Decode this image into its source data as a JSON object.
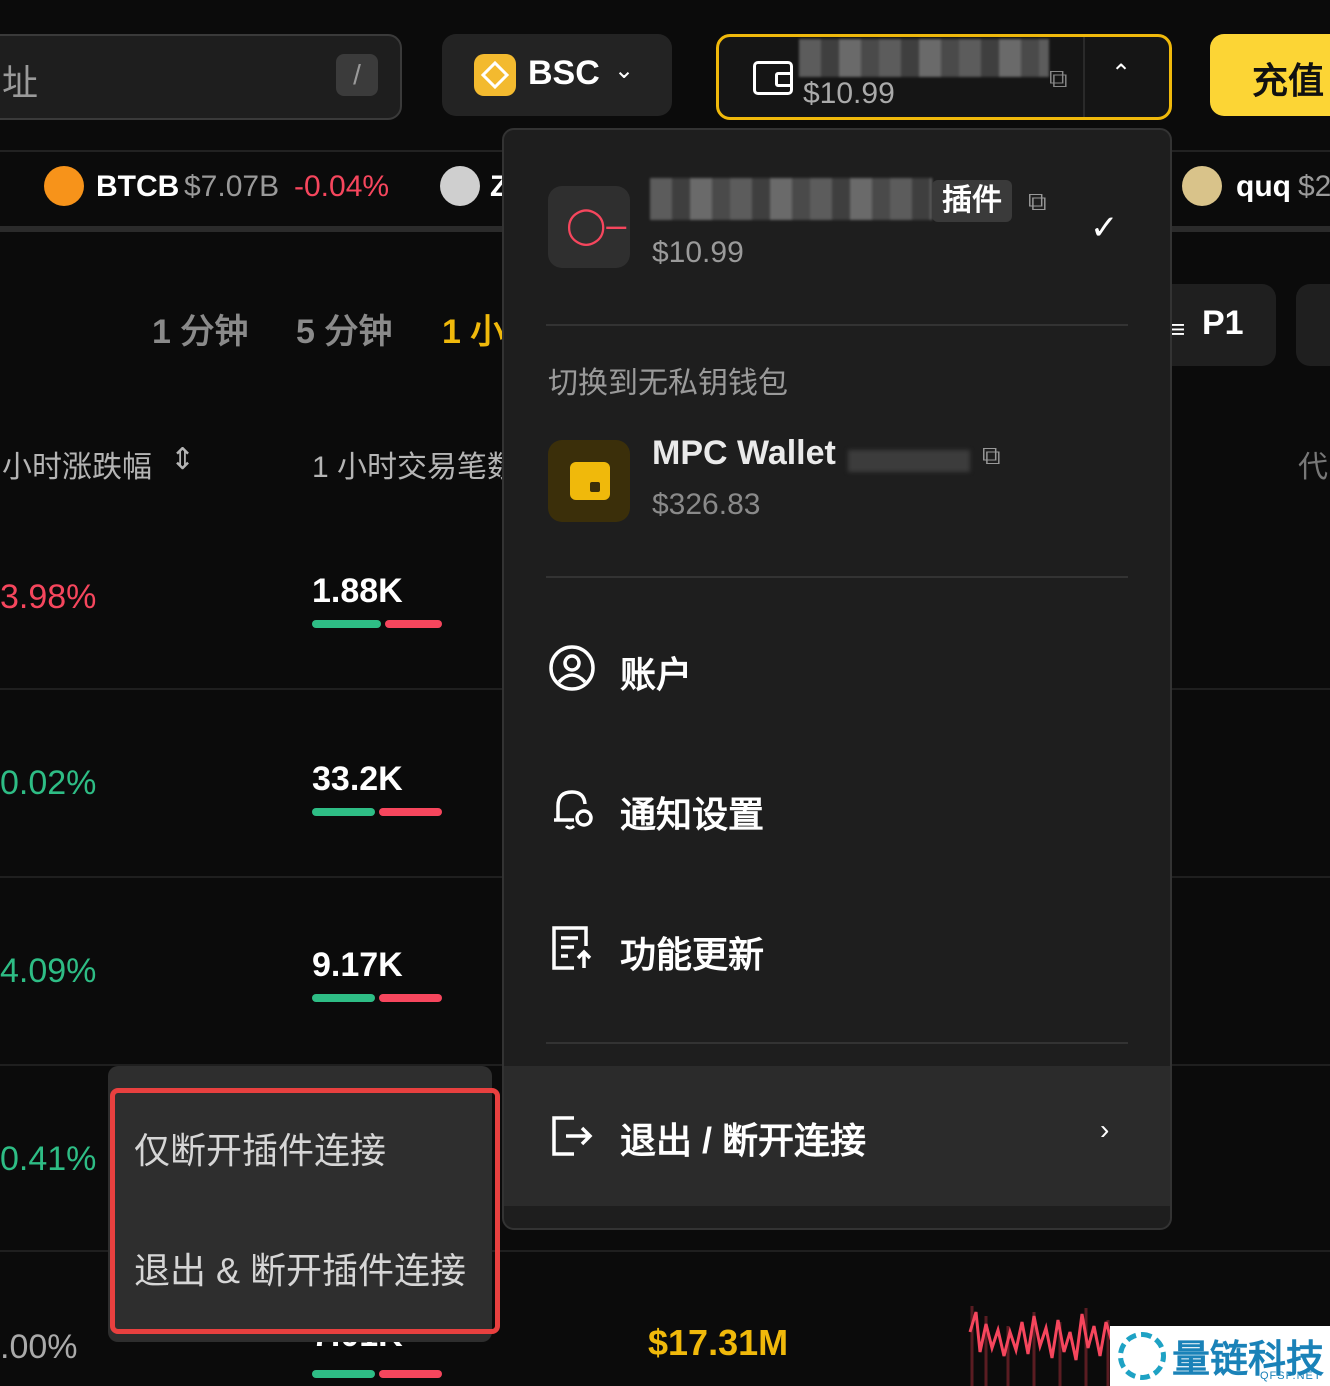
{
  "header": {
    "search_text": "址",
    "search_shortcut": "/",
    "chain": "BSC",
    "wallet_balance": "$10.99",
    "deposit_label": "充值"
  },
  "ticker": [
    {
      "symbol": "BTCB",
      "mcap": "$7.07B",
      "change": "-0.04%"
    },
    {
      "symbol": "Z"
    },
    {
      "symbol": "quq",
      "mcap": "$2"
    }
  ],
  "time_tabs": [
    "1 分钟",
    "5 分钟",
    "1 小"
  ],
  "filter_label": "P1",
  "table": {
    "headers": [
      "小时涨跌幅",
      "1 小时交易笔数",
      "代"
    ],
    "rows": [
      {
        "change": "3.98%",
        "tx": "1.88K",
        "buy": 0.55
      },
      {
        "change": "0.02%",
        "tx": "33.2K",
        "buy": 0.5
      },
      {
        "change": "4.09%",
        "tx": "9.17K",
        "buy": 0.5
      },
      {
        "change": "0.41%",
        "tx": ""
      },
      {
        "change": ".00%",
        "tx": "7.01K",
        "volume": "$17.31M",
        "buy": 0.5
      }
    ]
  },
  "dropdown": {
    "plugin_tag": "插件",
    "plugin_balance": "$10.99",
    "switch_label": "切换到无私钥钱包",
    "mpc_name": "MPC Wallet",
    "mpc_balance": "$326.83",
    "menu": [
      "账户",
      "通知设置",
      "功能更新"
    ],
    "logout": "退出 / 断开连接"
  },
  "submenu": [
    "仅断开插件连接",
    "退出 & 断开插件连接"
  ],
  "watermark": {
    "title": "量链科技",
    "sub": "QFSP.NET"
  },
  "colors": {
    "accent": "#f0b90b",
    "up": "#2ebd85",
    "down": "#f6465d",
    "highlight": "#e8403f"
  }
}
